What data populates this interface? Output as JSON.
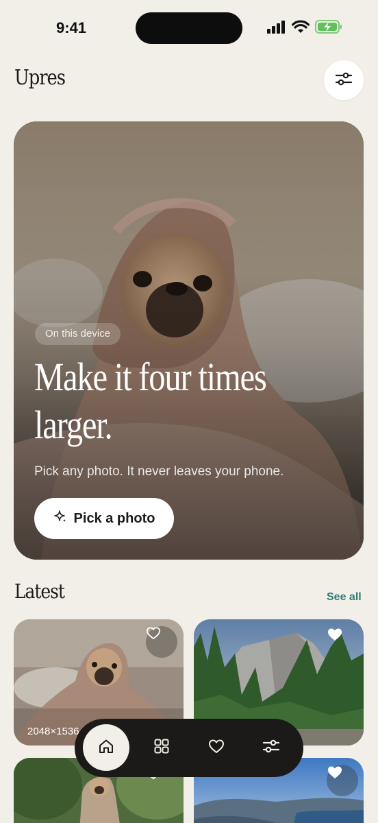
{
  "status_bar": {
    "time": "9:41"
  },
  "header": {
    "app_title": "Upres"
  },
  "hero": {
    "badge": "On this device",
    "headline_line1": "Make it four times",
    "headline_line2": "larger.",
    "subtitle": "Pick any photo. It never leaves your phone.",
    "button_label": "Pick a photo"
  },
  "latest": {
    "title": "Latest",
    "see_all": "See all",
    "items": [
      {
        "dimensions": "2048×1536",
        "favorited": false
      },
      {
        "dimensions": "",
        "favorited": true
      },
      {
        "dimensions": "",
        "favorited": false
      },
      {
        "dimensions": "",
        "favorited": true
      }
    ]
  },
  "tabbar": {
    "tabs": [
      {
        "icon": "home-icon",
        "active": true
      },
      {
        "icon": "grid-icon",
        "active": false
      },
      {
        "icon": "heart-icon",
        "active": false
      },
      {
        "icon": "sliders-icon",
        "active": false
      }
    ]
  },
  "colors": {
    "background": "#f2efe8",
    "accent": "#2f7a76",
    "tabbar": "#1b1a18"
  }
}
